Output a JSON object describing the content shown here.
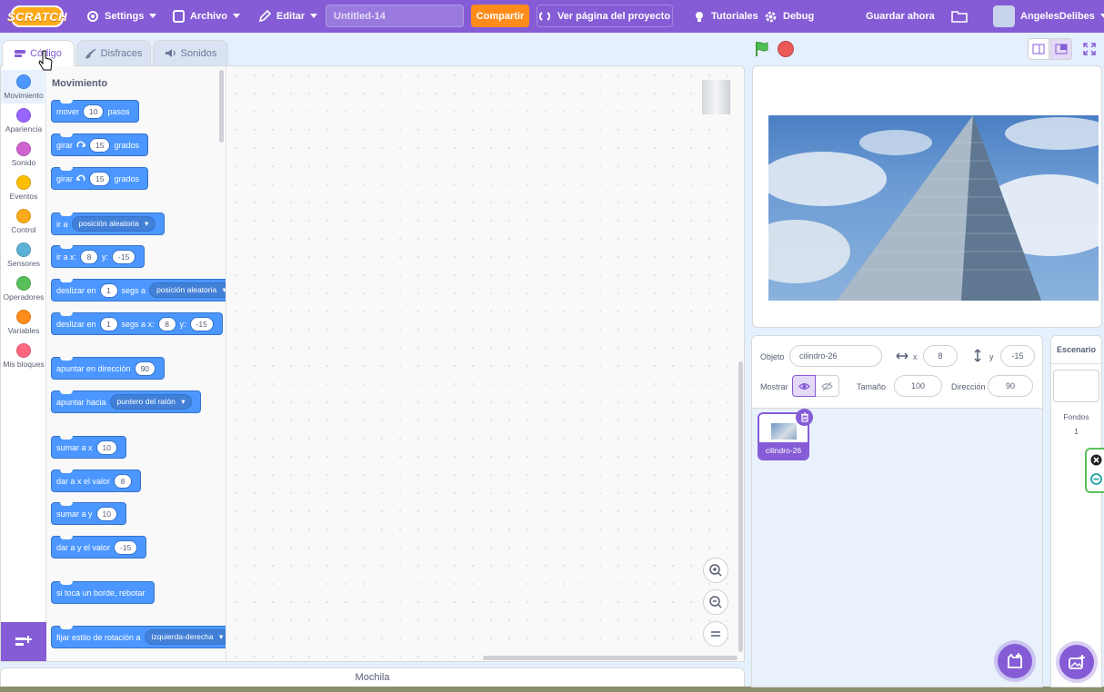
{
  "menubar": {
    "logo": "SCRATCH",
    "settings": "Settings",
    "file": "Archivo",
    "edit": "Editar",
    "project_title": "Untitled-14",
    "share": "Compartir",
    "see_project": "Ver página del proyecto",
    "tutorials": "Tutoriales",
    "debug": "Debug",
    "save_now": "Guardar ahora",
    "username": "AngelesDelibes"
  },
  "tabs": {
    "code": "Código",
    "costumes": "Disfraces",
    "sounds": "Sonidos"
  },
  "categories": [
    {
      "label": "Movimiento",
      "color": "#4c97ff"
    },
    {
      "label": "Apariencia",
      "color": "#9966ff"
    },
    {
      "label": "Sonido",
      "color": "#cf63cf"
    },
    {
      "label": "Eventos",
      "color": "#ffbf00"
    },
    {
      "label": "Control",
      "color": "#ffab19"
    },
    {
      "label": "Sensores",
      "color": "#5cb1d6"
    },
    {
      "label": "Operadores",
      "color": "#59c059"
    },
    {
      "label": "Variables",
      "color": "#ff8c1a"
    },
    {
      "label": "Mis bloques",
      "color": "#ff6680"
    }
  ],
  "palette": {
    "title": "Movimiento",
    "b1": {
      "a": "mover",
      "n": "10",
      "b": "pasos"
    },
    "b2": {
      "a": "girar",
      "n": "15",
      "b": "grados"
    },
    "b3": {
      "a": "girar",
      "n": "15",
      "b": "grados"
    },
    "b4": {
      "a": "ir a",
      "d": "posición aleatoria"
    },
    "b5": {
      "a": "ir a x:",
      "n1": "8",
      "b": "y:",
      "n2": "-15"
    },
    "b6": {
      "a": "deslizar en",
      "n": "1",
      "b": "segs a",
      "d": "posición aleatoria"
    },
    "b7": {
      "a": "deslizar en",
      "n": "1",
      "b": "segs a x:",
      "n1": "8",
      "c": "y:",
      "n2": "-15"
    },
    "b8": {
      "a": "apuntar en dirección",
      "n": "90"
    },
    "b9": {
      "a": "apuntar hacia",
      "d": "puntero del ratón"
    },
    "b10": {
      "a": "sumar a x",
      "n": "10"
    },
    "b11": {
      "a": "dar a x el valor",
      "n": "8"
    },
    "b12": {
      "a": "sumar a y",
      "n": "10"
    },
    "b13": {
      "a": "dar a y el valor",
      "n": "-15"
    },
    "b14": {
      "a": "si toca un borde, rebotar"
    },
    "b15": {
      "a": "fijar estilo de rotación a",
      "d": "izquierda-derecha"
    }
  },
  "backpack": "Mochila",
  "sprite_info": {
    "sprite_label": "Objeto",
    "sprite_name": "cilindro-26",
    "x_label": "x",
    "x_value": "8",
    "y_label": "y",
    "y_value": "-15",
    "show_label": "Mostrar",
    "size_label": "Tamaño",
    "size_value": "100",
    "direction_label": "Dirección",
    "direction_value": "90"
  },
  "sprites": [
    {
      "name": "cilindro-26"
    }
  ],
  "stage_selector": {
    "title": "Escenario",
    "backdrops_label": "Fondos",
    "backdrops_count": "1"
  }
}
